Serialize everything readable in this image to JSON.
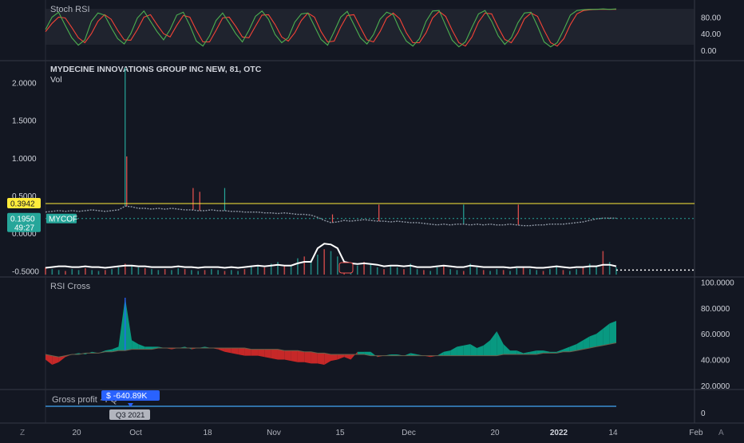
{
  "chart_data": {
    "type": "line",
    "title": "MYDECINE INNOVATIONS GROUP INC NEW, 81, OTC",
    "symbol": "MYCOF",
    "vol_label": "Vol",
    "x_ticks": [
      "20",
      "Oct",
      "18",
      "Nov",
      "15",
      "Dec",
      "20",
      "2022",
      "14",
      "Feb"
    ],
    "colors": {
      "background": "#131722",
      "up": "#26a69a",
      "down": "#ef5350",
      "rsi_up": "#089981",
      "rsi_down": "#c62828",
      "stoch_k": "#4caf50",
      "stoch_d": "#f44336",
      "accent": "#2962ff",
      "last_price": "#ffeb3b"
    },
    "panes": {
      "stoch_rsi": {
        "label": "Stoch RSI",
        "y_ticks": [
          "80.00",
          "40.00",
          "0.00"
        ],
        "ylim": [
          -10,
          110
        ],
        "k": [
          50,
          80,
          92,
          60,
          30,
          12,
          25,
          70,
          90,
          85,
          55,
          28,
          15,
          40,
          78,
          95,
          70,
          45,
          25,
          50,
          85,
          92,
          60,
          22,
          10,
          35,
          72,
          90,
          66,
          40,
          20,
          48,
          82,
          95,
          75,
          38,
          18,
          30,
          68,
          88,
          90,
          58,
          26,
          12,
          45,
          80,
          94,
          62,
          30,
          15,
          38,
          75,
          92,
          86,
          50,
          22,
          10,
          28,
          70,
          95,
          96,
          60,
          24,
          8,
          20,
          55,
          88,
          96,
          70,
          35,
          14,
          30,
          66,
          90,
          92,
          58,
          20,
          8,
          18,
          50,
          85,
          96,
          98,
          99,
          99,
          100,
          99,
          100
        ],
        "d": [
          45,
          65,
          80,
          78,
          55,
          30,
          18,
          40,
          70,
          86,
          75,
          48,
          25,
          24,
          50,
          80,
          86,
          62,
          40,
          32,
          60,
          84,
          80,
          48,
          20,
          20,
          48,
          78,
          80,
          58,
          32,
          30,
          58,
          85,
          86,
          62,
          32,
          22,
          42,
          72,
          90,
          80,
          45,
          20,
          22,
          56,
          84,
          86,
          55,
          25,
          20,
          45,
          78,
          90,
          76,
          42,
          18,
          18,
          42,
          78,
          94,
          82,
          48,
          18,
          10,
          32,
          68,
          90,
          88,
          55,
          26,
          18,
          42,
          76,
          90,
          82,
          48,
          18,
          10,
          28,
          62,
          88,
          96,
          98,
          99,
          99,
          99,
          99
        ]
      },
      "price": {
        "y_ticks": [
          "2.0000",
          "1.5000",
          "1.0000",
          "0.5000",
          "0.0000",
          "-0.5000"
        ],
        "ylim": [
          -0.55,
          2.25
        ],
        "last_price_label": "0.3942",
        "last_price": 0.3942,
        "current_price_label": "0.1950",
        "current_price": 0.195,
        "countdown": "49:27",
        "close": [
          0.28,
          0.29,
          0.3,
          0.29,
          0.3,
          0.29,
          0.3,
          0.31,
          0.3,
          0.29,
          0.3,
          0.31,
          0.36,
          0.35,
          0.33,
          0.33,
          0.32,
          0.33,
          0.32,
          0.33,
          0.32,
          0.31,
          0.31,
          0.3,
          0.3,
          0.31,
          0.3,
          0.3,
          0.29,
          0.29,
          0.28,
          0.28,
          0.28,
          0.27,
          0.27,
          0.26,
          0.27,
          0.26,
          0.25,
          0.25,
          0.24,
          0.21,
          0.17,
          0.14,
          0.15,
          0.17,
          0.16,
          0.17,
          0.18,
          0.17,
          0.16,
          0.16,
          0.15,
          0.16,
          0.15,
          0.14,
          0.14,
          0.13,
          0.12,
          0.11,
          0.12,
          0.11,
          0.12,
          0.12,
          0.11,
          0.12,
          0.11,
          0.12,
          0.11,
          0.11,
          0.12,
          0.11,
          0.1,
          0.1,
          0.11,
          0.11,
          0.12,
          0.12,
          0.12,
          0.13,
          0.14,
          0.15,
          0.17,
          0.19,
          0.2,
          0.2,
          0.2
        ],
        "spikes": [
          {
            "i": 12,
            "v": 2.2,
            "dir": "up"
          },
          {
            "i": 12,
            "v": 1.02,
            "dir": "down"
          },
          {
            "i": 22,
            "v": 0.6,
            "dir": "down"
          },
          {
            "i": 23,
            "v": 0.55,
            "dir": "down"
          },
          {
            "i": 27,
            "v": 0.6,
            "dir": "up"
          },
          {
            "i": 43,
            "v": 0.25,
            "dir": "down"
          },
          {
            "i": 50,
            "v": 0.38,
            "dir": "down"
          },
          {
            "i": 63,
            "v": 0.38,
            "dir": "up"
          },
          {
            "i": 71,
            "v": 0.38,
            "dir": "down"
          }
        ],
        "volume": [
          8,
          6,
          5,
          4,
          6,
          5,
          7,
          5,
          4,
          5,
          6,
          8,
          12,
          10,
          8,
          7,
          6,
          5,
          6,
          5,
          7,
          6,
          5,
          4,
          5,
          6,
          5,
          4,
          5,
          4,
          6,
          9,
          10,
          8,
          12,
          14,
          10,
          9,
          18,
          20,
          16,
          22,
          28,
          26,
          20,
          15,
          12,
          10,
          14,
          12,
          8,
          6,
          10,
          8,
          6,
          12,
          6,
          5,
          4,
          8,
          10,
          6,
          5,
          4,
          12,
          8,
          5,
          4,
          6,
          5,
          4,
          7,
          8,
          6,
          5,
          4,
          6,
          10,
          5,
          4,
          6,
          8,
          12,
          10,
          26,
          14,
          8
        ],
        "volume_avg": [
          0.04,
          0.05,
          0.06,
          0.06,
          0.05,
          0.05,
          0.06,
          0.05,
          0.05,
          0.04,
          0.05,
          0.06,
          0.07,
          0.07,
          0.06,
          0.06,
          0.05,
          0.05,
          0.05,
          0.05,
          0.06,
          0.05,
          0.05,
          0.04,
          0.05,
          0.05,
          0.05,
          0.04,
          0.05,
          0.04,
          0.05,
          0.06,
          0.07,
          0.06,
          0.07,
          0.08,
          0.07,
          0.07,
          0.1,
          0.12,
          0.12,
          0.3,
          0.36,
          0.35,
          0.3,
          0.12,
          0.1,
          0.09,
          0.1,
          0.09,
          0.08,
          0.06,
          0.07,
          0.07,
          0.06,
          0.07,
          0.05,
          0.05,
          0.05,
          0.06,
          0.07,
          0.06,
          0.05,
          0.05,
          0.07,
          0.06,
          0.05,
          0.05,
          0.05,
          0.05,
          0.04,
          0.05,
          0.05,
          0.05,
          0.04,
          0.04,
          0.05,
          0.06,
          0.05,
          0.04,
          0.05,
          0.05,
          0.06,
          0.06,
          0.08,
          0.08,
          0.06
        ]
      },
      "rsi_cross": {
        "label": "RSI Cross",
        "y_ticks": [
          "100.0000",
          "80.0000",
          "60.0000",
          "40.0000",
          "20.0000"
        ],
        "ylim": [
          18,
          101
        ],
        "base": [
          44,
          43,
          42,
          43,
          44,
          44,
          45,
          45,
          45,
          46,
          46,
          47,
          47,
          48,
          48,
          48,
          48,
          49,
          49,
          49,
          49,
          49,
          49,
          49,
          49,
          49,
          49,
          49,
          49,
          49,
          49,
          48,
          48,
          48,
          48,
          48,
          47,
          47,
          47,
          46,
          46,
          45,
          45,
          44,
          44,
          44,
          44,
          44,
          44,
          43,
          43,
          43,
          43,
          43,
          43,
          43,
          43,
          43,
          43,
          43,
          43,
          43,
          43,
          43,
          43,
          43,
          43,
          43,
          43,
          44,
          44,
          44,
          44,
          44,
          44,
          45,
          45,
          45,
          46,
          46,
          47,
          48,
          49,
          50,
          51,
          52,
          53
        ],
        "rsi": [
          40,
          36,
          38,
          42,
          44,
          45,
          44,
          46,
          45,
          47,
          48,
          50,
          88,
          55,
          52,
          50,
          50,
          50,
          49,
          48,
          49,
          50,
          48,
          49,
          50,
          49,
          48,
          46,
          45,
          44,
          43,
          43,
          43,
          42,
          41,
          40,
          40,
          39,
          38,
          38,
          37,
          37,
          36,
          39,
          40,
          42,
          40,
          46,
          46,
          46,
          42,
          43,
          44,
          44,
          43,
          45,
          44,
          43,
          42,
          43,
          46,
          47,
          50,
          51,
          52,
          49,
          51,
          55,
          62,
          52,
          47,
          47,
          45,
          46,
          47,
          47,
          46,
          46,
          48,
          50,
          52,
          55,
          58,
          60,
          64,
          68,
          70
        ]
      },
      "gross_profit": {
        "label": "Gross profit · FQ",
        "value_label": "$ -640.89K",
        "period_label": "Q3 2021",
        "y_ticks": [
          "0"
        ]
      }
    },
    "corner_labels": {
      "left": "Z",
      "right": "A"
    }
  }
}
